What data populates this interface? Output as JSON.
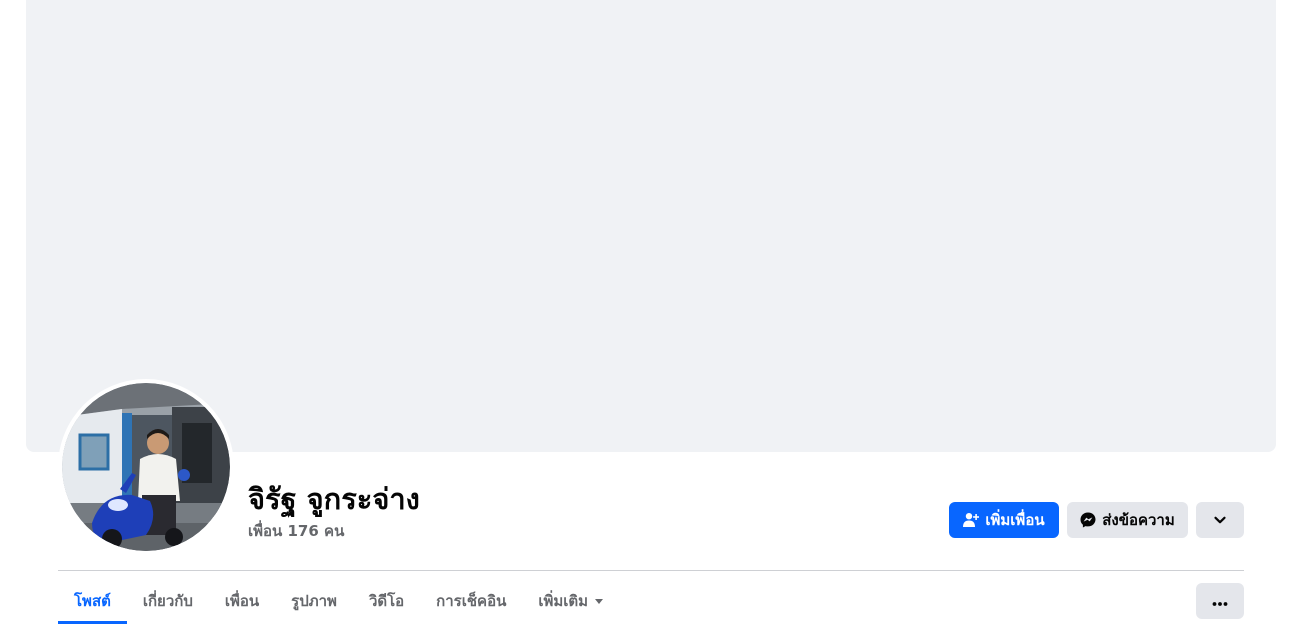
{
  "profile": {
    "name": "จิรัฐ จูกระจ่าง",
    "friends_count": "เพื่อน 176 คน"
  },
  "actions": {
    "add_friend_label": "เพิ่มเพื่อน",
    "message_label": "ส่งข้อความ"
  },
  "tabs": [
    {
      "label": "โพสต์",
      "active": true
    },
    {
      "label": "เกี่ยวกับ",
      "active": false
    },
    {
      "label": "เพื่อน",
      "active": false
    },
    {
      "label": "รูปภาพ",
      "active": false
    },
    {
      "label": "วิดีโอ",
      "active": false
    },
    {
      "label": "การเช็คอิน",
      "active": false
    },
    {
      "label": "เพิ่มเติม",
      "active": false
    }
  ],
  "colors": {
    "accent": "#0866ff",
    "cover_bg": "#f0f2f5",
    "secondary_button": "#e4e6eb",
    "secondary_text": "#65676b"
  },
  "icons": {
    "add_friend": "person-plus-icon",
    "message": "messenger-icon",
    "expand": "chevron-down-icon",
    "more_tab": "caret-down-icon",
    "options": "ellipsis-icon"
  }
}
